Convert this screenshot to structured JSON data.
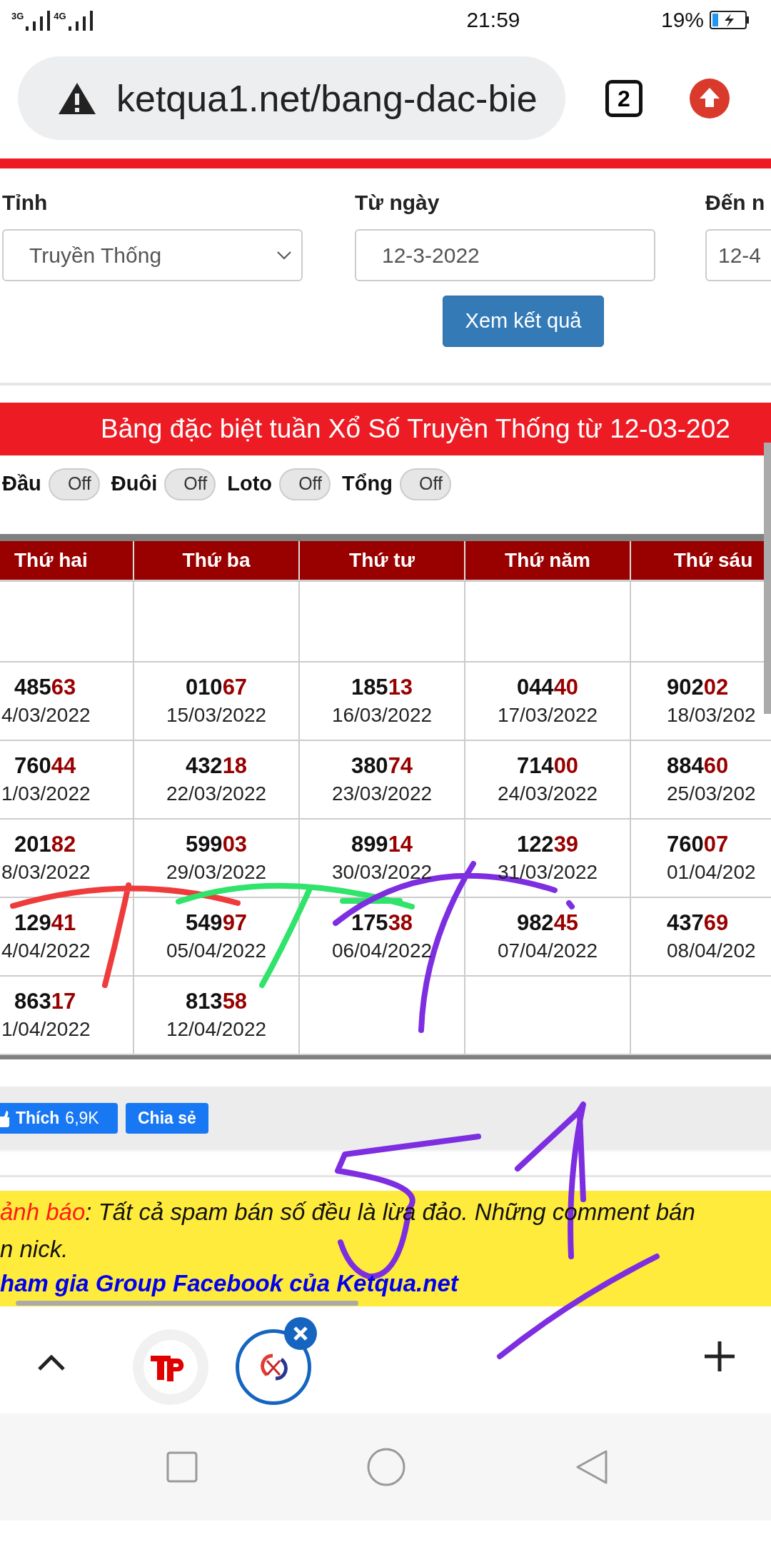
{
  "status_bar": {
    "network_1": "3G",
    "network_2": "4G",
    "time": "21:59",
    "battery": "19%"
  },
  "browser": {
    "url": "ketqua1.net/bang-dac-bie",
    "tab_count": "2"
  },
  "form": {
    "fields": [
      {
        "label": "Tỉnh",
        "value": "Truyền Thống",
        "kind": "select"
      },
      {
        "label": "Từ ngày",
        "value": "12-3-2022",
        "kind": "input"
      },
      {
        "label": "Đến n",
        "value": "12-4",
        "kind": "input"
      }
    ],
    "submit": "Xem kết quả"
  },
  "banner": "Bảng đặc biệt tuần Xổ Số Truyền Thống từ 12-03-202",
  "toggles": [
    {
      "label": "Đầu",
      "text": "Off",
      "on": false
    },
    {
      "label": "Đuôi",
      "text": "Off",
      "on": false
    },
    {
      "label": "Loto",
      "text": "Off",
      "on": false
    },
    {
      "label": "Tổng",
      "text": "Off",
      "on": false
    }
  ],
  "table": {
    "columns": [
      "Thứ hai",
      "Thứ ba",
      "Thứ tư",
      "Thứ năm",
      "Thứ sáu"
    ],
    "rows": [
      [
        {},
        {},
        {},
        {},
        {}
      ],
      [
        {
          "head": "485",
          "tail": "63",
          "date": "4/03/2022"
        },
        {
          "head": "010",
          "tail": "67",
          "date": "15/03/2022"
        },
        {
          "head": "185",
          "tail": "13",
          "date": "16/03/2022"
        },
        {
          "head": "044",
          "tail": "40",
          "date": "17/03/2022"
        },
        {
          "head": "902",
          "tail": "02",
          "date": "18/03/202"
        }
      ],
      [
        {
          "head": "760",
          "tail": "44",
          "date": "1/03/2022"
        },
        {
          "head": "432",
          "tail": "18",
          "date": "22/03/2022"
        },
        {
          "head": "380",
          "tail": "74",
          "date": "23/03/2022"
        },
        {
          "head": "714",
          "tail": "00",
          "date": "24/03/2022"
        },
        {
          "head": "884",
          "tail": "60",
          "date": "25/03/202"
        }
      ],
      [
        {
          "head": "201",
          "tail": "82",
          "date": "8/03/2022"
        },
        {
          "head": "599",
          "tail": "03",
          "date": "29/03/2022"
        },
        {
          "head": "899",
          "tail": "14",
          "date": "30/03/2022"
        },
        {
          "head": "122",
          "tail": "39",
          "date": "31/03/2022"
        },
        {
          "head": "760",
          "tail": "07",
          "date": "01/04/202"
        }
      ],
      [
        {
          "head": "129",
          "tail": "41",
          "date": "4/04/2022"
        },
        {
          "head": "549",
          "tail": "97",
          "date": "05/04/2022"
        },
        {
          "head": "175",
          "tail": "38",
          "date": "06/04/2022"
        },
        {
          "head": "982",
          "tail": "45",
          "date": "07/04/2022"
        },
        {
          "head": "437",
          "tail": "69",
          "date": "08/04/202"
        }
      ],
      [
        {
          "head": "863",
          "tail": "17",
          "date": "1/04/2022"
        },
        {
          "head": "813",
          "tail": "58",
          "date": "12/04/2022"
        },
        {},
        {},
        {}
      ]
    ]
  },
  "social": {
    "like": "Thích",
    "like_count": "6,9K",
    "share": "Chia sẻ"
  },
  "warning": {
    "label": "ảnh báo",
    "text": ": Tất cả spam bán số đều là lừa đảo. Những comment bán",
    "line_2": "n nick.",
    "link": "ham gia Group Facebook của Ketqua.net"
  },
  "ink_strokes": [
    {
      "color": "#ee3b3b"
    },
    {
      "color": "#2fe36b"
    },
    {
      "color": "#7d2ee0"
    },
    {
      "color": "#7d2ee0"
    },
    {
      "color": "#7d2ee0"
    }
  ]
}
